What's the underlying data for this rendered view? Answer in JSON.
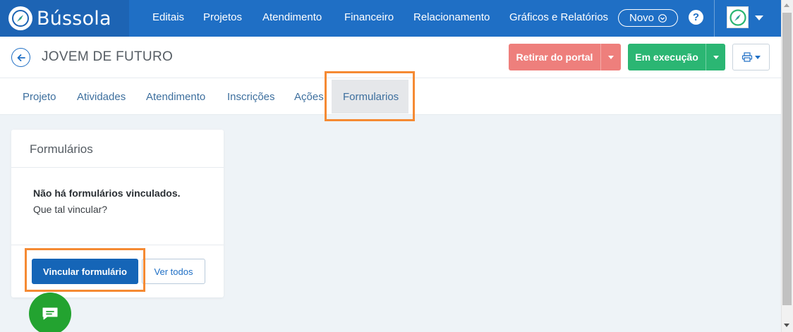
{
  "app": {
    "name": "Bússola"
  },
  "nav": {
    "items": [
      "Editais",
      "Projetos",
      "Atendimento",
      "Financeiro",
      "Relacionamento",
      "Gráficos e Relatórios"
    ],
    "novo_label": "Novo",
    "help_symbol": "?"
  },
  "page": {
    "title": "JOVEM DE FUTURO",
    "retirar_label": "Retirar do portal",
    "status_label": "Em execução"
  },
  "tabs": [
    "Projeto",
    "Atividades",
    "Atendimento",
    "Inscrições",
    "Ações",
    "Formularios"
  ],
  "active_tab": "Formularios",
  "card": {
    "title": "Formulários",
    "empty_title": "Não há formulários vinculados.",
    "empty_subtitle": "Que tal vincular?",
    "primary_button": "Vincular formulário",
    "secondary_button": "Ver todos"
  },
  "colors": {
    "nav_bg": "#1f6fc5",
    "brand_bg": "#1d64b4",
    "danger": "#ee7f7c",
    "success": "#2bb673",
    "primary": "#1565b7",
    "highlight": "#f58a33",
    "chat": "#23a330"
  },
  "icons": {
    "brand": "compass-icon",
    "help": "help-icon",
    "back": "arrow-left-icon",
    "print": "printer-icon",
    "chat": "chat-icon"
  }
}
